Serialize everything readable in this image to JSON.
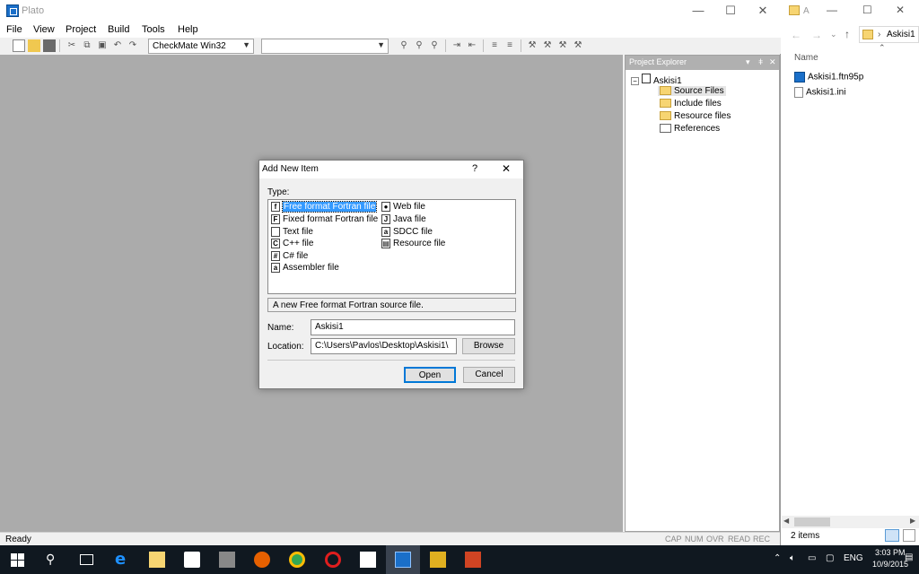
{
  "window": {
    "title": "Plato",
    "min": "—",
    "max": "☐",
    "close": "✕"
  },
  "menu": [
    "File",
    "View",
    "Project",
    "Build",
    "Tools",
    "Help"
  ],
  "toolbar": {
    "config_combo": "CheckMate  Win32",
    "second_combo": ""
  },
  "project_explorer": {
    "title": "Project Explorer",
    "controls": [
      "▾",
      "ǂ",
      "✕"
    ],
    "root": "Askisi1",
    "items": [
      "Source Files",
      "Include files",
      "Resource files",
      "References"
    ]
  },
  "status": {
    "left": "Ready",
    "indicators": [
      "CAP",
      "NUM",
      "OVR",
      "READ",
      "REC"
    ]
  },
  "dialog": {
    "title": "Add New Item",
    "help": "?",
    "close": "✕",
    "type_label": "Type:",
    "types_col1": [
      {
        "icon": "f",
        "label": "Free format Fortran file"
      },
      {
        "icon": "F",
        "label": "Fixed format Fortran file"
      },
      {
        "icon": "",
        "label": "Text file"
      },
      {
        "icon": "C",
        "label": "C++ file"
      },
      {
        "icon": "#",
        "label": "C# file"
      },
      {
        "icon": "a",
        "label": "Assembler file"
      }
    ],
    "types_col2": [
      {
        "icon": "●",
        "label": "Web file"
      },
      {
        "icon": "J",
        "label": "Java file"
      },
      {
        "icon": "a",
        "label": "SDCC file"
      },
      {
        "icon": "▤",
        "label": "Resource file"
      }
    ],
    "description": "A new Free format Fortran source file.",
    "name_label": "Name:",
    "name_value": "Askisi1",
    "location_label": "Location:",
    "location_value": "C:\\Users\\Pavlos\\Desktop\\Askisi1\\",
    "browse": "Browse",
    "open": "Open",
    "cancel": "Cancel"
  },
  "explorer": {
    "title": "A",
    "path": "Askisi1",
    "column": "Name",
    "files": [
      "Askisi1.ftn95p",
      "Askisi1.ini"
    ],
    "count": "2 items"
  },
  "taskbar": {
    "time": "3:03 PM",
    "date": "10/9/2015",
    "lang": "ENG"
  }
}
